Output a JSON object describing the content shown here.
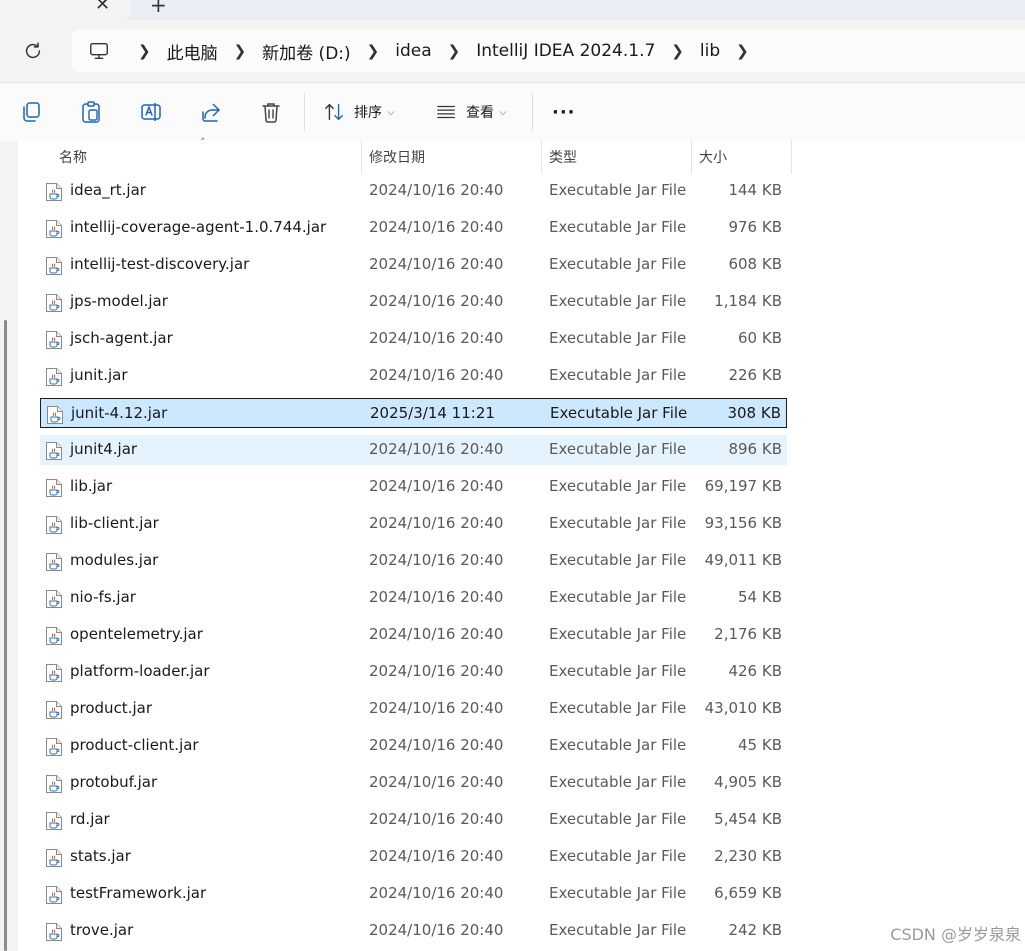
{
  "window": {
    "new_tab_label": "+",
    "close_tab_label": "✕"
  },
  "breadcrumb": [
    "此电脑",
    "新加卷 (D:)",
    "idea",
    "IntelliJ IDEA 2024.1.7",
    "lib"
  ],
  "toolbar": {
    "sort_label": "排序",
    "view_label": "查看",
    "more_label": "···"
  },
  "columns": {
    "name": "名称",
    "date": "修改日期",
    "type": "类型",
    "size": "大小"
  },
  "files": [
    {
      "name": "idea_rt.jar",
      "date": "2024/10/16 20:40",
      "type": "Executable Jar File",
      "size": "144 KB"
    },
    {
      "name": "intellij-coverage-agent-1.0.744.jar",
      "date": "2024/10/16 20:40",
      "type": "Executable Jar File",
      "size": "976 KB"
    },
    {
      "name": "intellij-test-discovery.jar",
      "date": "2024/10/16 20:40",
      "type": "Executable Jar File",
      "size": "608 KB"
    },
    {
      "name": "jps-model.jar",
      "date": "2024/10/16 20:40",
      "type": "Executable Jar File",
      "size": "1,184 KB"
    },
    {
      "name": "jsch-agent.jar",
      "date": "2024/10/16 20:40",
      "type": "Executable Jar File",
      "size": "60 KB"
    },
    {
      "name": "junit.jar",
      "date": "2024/10/16 20:40",
      "type": "Executable Jar File",
      "size": "226 KB"
    },
    {
      "name": "junit-4.12.jar",
      "date": "2025/3/14 11:21",
      "type": "Executable Jar File",
      "size": "308 KB",
      "state": "selected"
    },
    {
      "name": "junit4.jar",
      "date": "2024/10/16 20:40",
      "type": "Executable Jar File",
      "size": "896 KB",
      "state": "hover"
    },
    {
      "name": "lib.jar",
      "date": "2024/10/16 20:40",
      "type": "Executable Jar File",
      "size": "69,197 KB"
    },
    {
      "name": "lib-client.jar",
      "date": "2024/10/16 20:40",
      "type": "Executable Jar File",
      "size": "93,156 KB"
    },
    {
      "name": "modules.jar",
      "date": "2024/10/16 20:40",
      "type": "Executable Jar File",
      "size": "49,011 KB"
    },
    {
      "name": "nio-fs.jar",
      "date": "2024/10/16 20:40",
      "type": "Executable Jar File",
      "size": "54 KB"
    },
    {
      "name": "opentelemetry.jar",
      "date": "2024/10/16 20:40",
      "type": "Executable Jar File",
      "size": "2,176 KB"
    },
    {
      "name": "platform-loader.jar",
      "date": "2024/10/16 20:40",
      "type": "Executable Jar File",
      "size": "426 KB"
    },
    {
      "name": "product.jar",
      "date": "2024/10/16 20:40",
      "type": "Executable Jar File",
      "size": "43,010 KB"
    },
    {
      "name": "product-client.jar",
      "date": "2024/10/16 20:40",
      "type": "Executable Jar File",
      "size": "45 KB"
    },
    {
      "name": "protobuf.jar",
      "date": "2024/10/16 20:40",
      "type": "Executable Jar File",
      "size": "4,905 KB"
    },
    {
      "name": "rd.jar",
      "date": "2024/10/16 20:40",
      "type": "Executable Jar File",
      "size": "5,454 KB"
    },
    {
      "name": "stats.jar",
      "date": "2024/10/16 20:40",
      "type": "Executable Jar File",
      "size": "2,230 KB"
    },
    {
      "name": "testFramework.jar",
      "date": "2024/10/16 20:40",
      "type": "Executable Jar File",
      "size": "6,659 KB"
    },
    {
      "name": "trove.jar",
      "date": "2024/10/16 20:40",
      "type": "Executable Jar File",
      "size": "242 KB"
    }
  ],
  "watermark": "CSDN @岁岁泉泉"
}
